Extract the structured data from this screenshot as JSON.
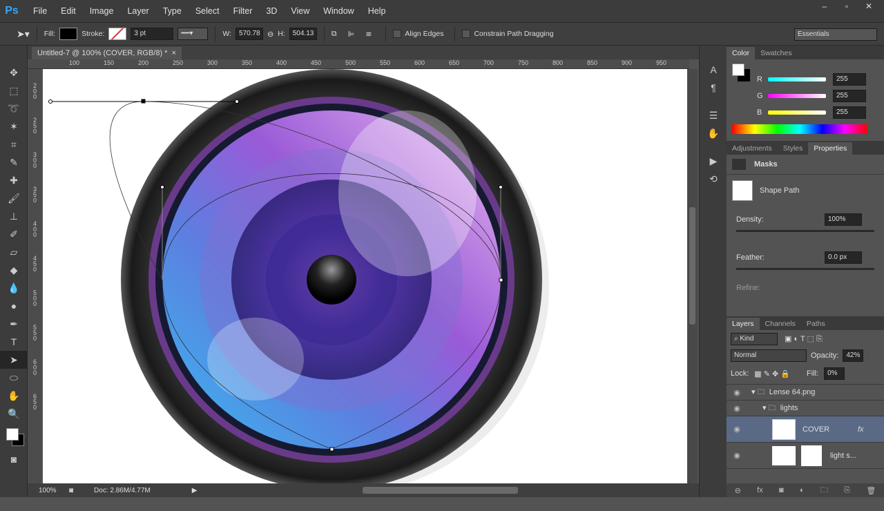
{
  "app": {
    "logo": "Ps"
  },
  "menu": [
    "File",
    "Edit",
    "Image",
    "Layer",
    "Type",
    "Select",
    "Filter",
    "3D",
    "View",
    "Window",
    "Help"
  ],
  "options": {
    "fill_label": "Fill:",
    "stroke_label": "Stroke:",
    "stroke_width": "3 pt",
    "w_label": "W:",
    "w_value": "570.78",
    "h_label": "H:",
    "h_value": "504.13",
    "align_edges": "Align Edges",
    "constrain": "Constrain Path Dragging",
    "workspace": "Essentials"
  },
  "document": {
    "tab_title": "Untitled-7 @ 100% (COVER, RGB/8) *",
    "close": "×"
  },
  "hruler": [
    "100",
    "150",
    "200",
    "250",
    "300",
    "350",
    "400",
    "450",
    "500",
    "550",
    "600",
    "650",
    "700",
    "750",
    "800",
    "850",
    "900",
    "950"
  ],
  "vruler": [
    "200",
    "250",
    "300",
    "350",
    "400",
    "450",
    "500",
    "550",
    "600",
    "650"
  ],
  "status": {
    "zoom": "100%",
    "doc": "Doc: 2.86M/4.77M"
  },
  "color_panel": {
    "tabs": [
      "Color",
      "Swatches"
    ],
    "channels": [
      {
        "label": "R",
        "value": "255"
      },
      {
        "label": "G",
        "value": "255"
      },
      {
        "label": "B",
        "value": "255"
      }
    ]
  },
  "properties_panel": {
    "tabs": [
      "Adjustments",
      "Styles",
      "Properties"
    ],
    "title": "Masks",
    "shape_path": "Shape Path",
    "density_label": "Density:",
    "density": "100%",
    "feather_label": "Feather:",
    "feather": "0.0 px",
    "refine": "Refine:"
  },
  "layers_panel": {
    "tabs": [
      "Layers",
      "Channels",
      "Paths"
    ],
    "kind": "Kind",
    "blend": "Normal",
    "opacity_label": "Opacity:",
    "opacity": "42%",
    "lock_label": "Lock:",
    "fill_label": "Fill:",
    "fill": "0%",
    "layers": [
      {
        "name": "Lense 64.png",
        "type": "group"
      },
      {
        "name": "lights",
        "type": "group"
      },
      {
        "name": "COVER",
        "type": "shape",
        "selected": true
      },
      {
        "name": "light s...",
        "type": "layer"
      }
    ]
  },
  "colors": {
    "accent": "#31a8ff",
    "selected_layer": "#5a6a86"
  }
}
